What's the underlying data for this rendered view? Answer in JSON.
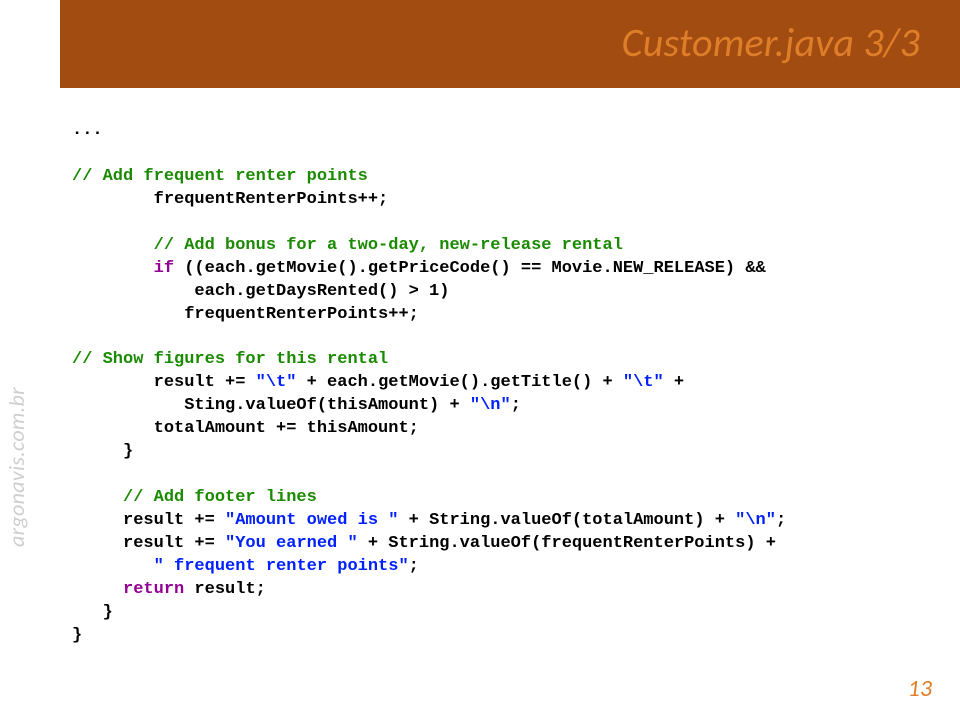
{
  "title": "Customer.java 3/3",
  "watermark": "argonavis.com.br",
  "page_number": "13",
  "code": {
    "l01": "...",
    "c02": "// Add frequent renter points",
    "l03": "        frequentRenterPoints++;",
    "c04": "        // Add bonus for a two-day, new-release rental",
    "l05a": "        ",
    "k05": "if",
    "l05b": " ((each.getMovie().getPriceCode() == Movie.NEW_RELEASE) &&",
    "l06": "            each.getDaysRented() > 1)",
    "l07": "           frequentRenterPoints++;",
    "c08": "// Show figures for this rental",
    "l09a": "        result += ",
    "s09a": "\"\\t\"",
    "l09b": " + each.getMovie().getTitle() + ",
    "s09c": "\"\\t\"",
    "l09d": " +",
    "l10a": "           Sting.valueOf(thisAmount) + ",
    "s10": "\"\\n\"",
    "l10b": ";",
    "l11": "        totalAmount += thisAmount;",
    "l12": "     }",
    "c13": "     // Add footer lines",
    "l14a": "     result += ",
    "s14a": "\"Amount owed is \"",
    "l14b": " + String.valueOf(totalAmount) + ",
    "s14c": "\"\\n\"",
    "l14d": ";",
    "l15a": "     result += ",
    "s15a": "\"You earned \"",
    "l15b": " + String.valueOf(frequentRenterPoints) +",
    "l16a": "        ",
    "s16": "\" frequent renter points\"",
    "l16b": ";",
    "l17a": "     ",
    "k17": "return",
    "l17b": " result;",
    "l18": "   }",
    "l19": "}"
  }
}
